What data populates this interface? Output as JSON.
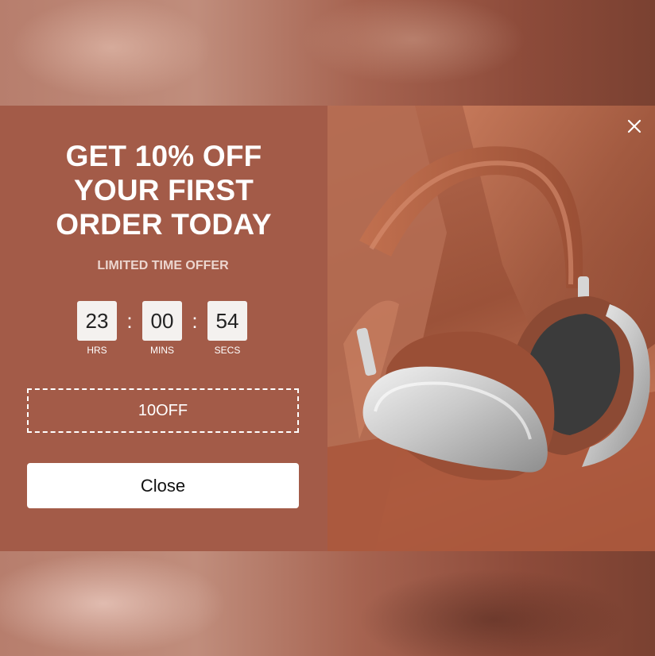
{
  "popup": {
    "headline": "GET 10% OFF\nYOUR FIRST\nORDER TODAY",
    "subhead": "LIMITED TIME OFFER",
    "countdown": {
      "hours": "23",
      "minutes": "00",
      "seconds": "54",
      "hours_label": "HRS",
      "minutes_label": "MINS",
      "seconds_label": "SECS",
      "separator": ":"
    },
    "coupon_code": "10OFF",
    "close_label": "Close",
    "close_icon": "close-icon",
    "image": "headphones-product-image"
  },
  "colors": {
    "panel_bg": "#a35b48",
    "accent_text": "#ecd6cf",
    "button_bg": "#ffffff"
  }
}
